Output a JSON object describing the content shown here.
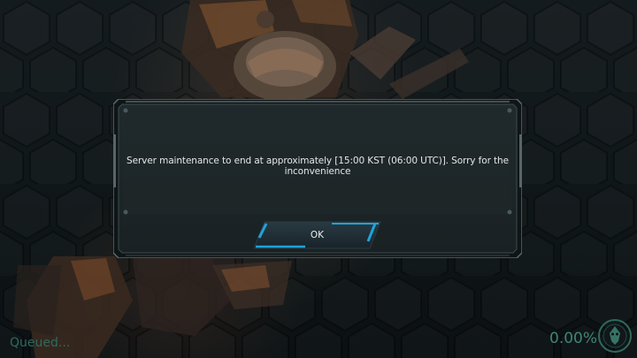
{
  "dialog": {
    "message": "Server maintenance to end at approximately [15:00 KST (06:00 UTC)]. Sorry for the inconvenience",
    "ok_label": "OK"
  },
  "status": {
    "queued_text": "Queued...",
    "progress_percent": "0.00%",
    "progress_value": 0
  },
  "icons": {
    "logo": "mech-emblem-icon"
  },
  "colors": {
    "status_text": "#3e8575",
    "button_accent": "#1fa3d9",
    "dialog_bg": "#1d2628"
  }
}
